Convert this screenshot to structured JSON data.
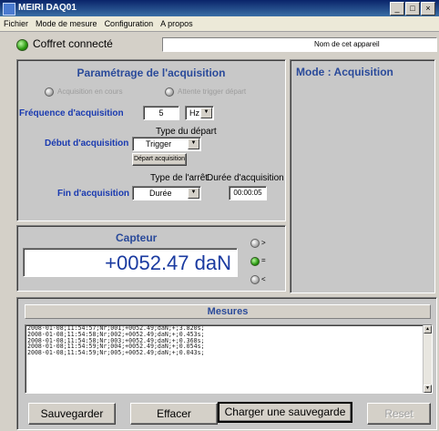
{
  "window": {
    "title": "MEIRI DAQ01"
  },
  "menu": [
    "Fichier",
    "Mode de mesure",
    "Configuration",
    "A propos"
  ],
  "status": {
    "text": "Coffret connecté",
    "device_name_label": "Nom de cet appareil"
  },
  "acquisition": {
    "title": "Paramétrage de l'acquisition",
    "running_label": "Acquisition en cours",
    "waiting_label": "Attente trigger départ",
    "freq_label": "Fréquence d'acquisition",
    "freq_value": "5",
    "freq_unit": "Hz",
    "start_type_label": "Type du départ",
    "start_label": "Début d'acquisition",
    "start_value": "Trigger",
    "start_button": "Départ acquisition",
    "stop_type_label": "Type de l'arrêt",
    "duration_label": "Durée d'acquisition",
    "end_label": "Fin d'acquisition",
    "end_value": "Durée",
    "duration_value": "00:00:05"
  },
  "mode": {
    "title": "Mode : Acquisition"
  },
  "sensor": {
    "title": "Capteur",
    "value": "+0052.47 daN"
  },
  "measures": {
    "title": "Mesures",
    "lines": [
      "2008-01-08;11:54:57;Nr;001;+0052.49;daN;+;3.820s;",
      "2008-01-08;11:54:58;Nr;002;+0052.49;daN;+;0.453s;",
      "2008-01-08;11:54:58;Nr;003;+0052.49;daN;+;0.368s;",
      "2008-01-08;11:54:59;Nr;004;+0052.49;daN;+;0.054s;",
      "2008-01-08;11:54:59;Nr;005;+0052.49;daN;+;0.043s;"
    ]
  },
  "buttons": {
    "save": "Sauvegarder",
    "clear": "Effacer",
    "load": "Charger une sauvegarde",
    "reset": "Reset"
  }
}
